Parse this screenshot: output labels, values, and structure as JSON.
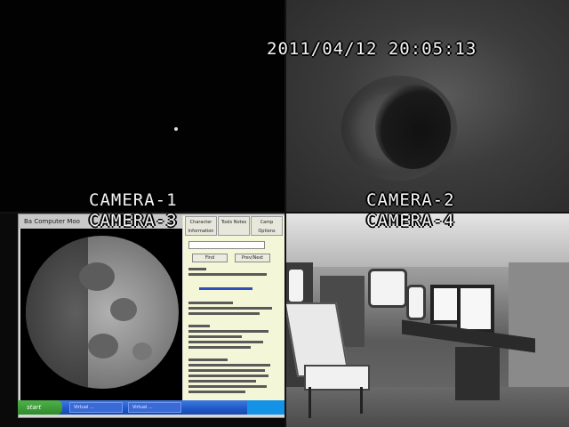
{
  "overlay": {
    "timestamp": "2011/04/12 20:05:13",
    "camera_labels": [
      "CAMERA-1",
      "CAMERA-2",
      "CAMERA-3",
      "CAMERA-4"
    ]
  },
  "camera3_screen": {
    "window_title": "Ba  Computer  Moo",
    "tabs": [
      "Character\nInformation",
      "Tools\nNotes",
      "Camp\nOptions"
    ],
    "buttons": [
      "Find",
      "Prev/Next"
    ],
    "taskbar": {
      "start_label": "start",
      "items": [
        "Virtual ...",
        "Virtual ..."
      ]
    }
  },
  "colors": {
    "osd_text": "#f4f4f4",
    "taskbar_blue": "#1e57c7",
    "start_green": "#2e8c2a",
    "info_panel_bg": "#f4f6d8"
  }
}
